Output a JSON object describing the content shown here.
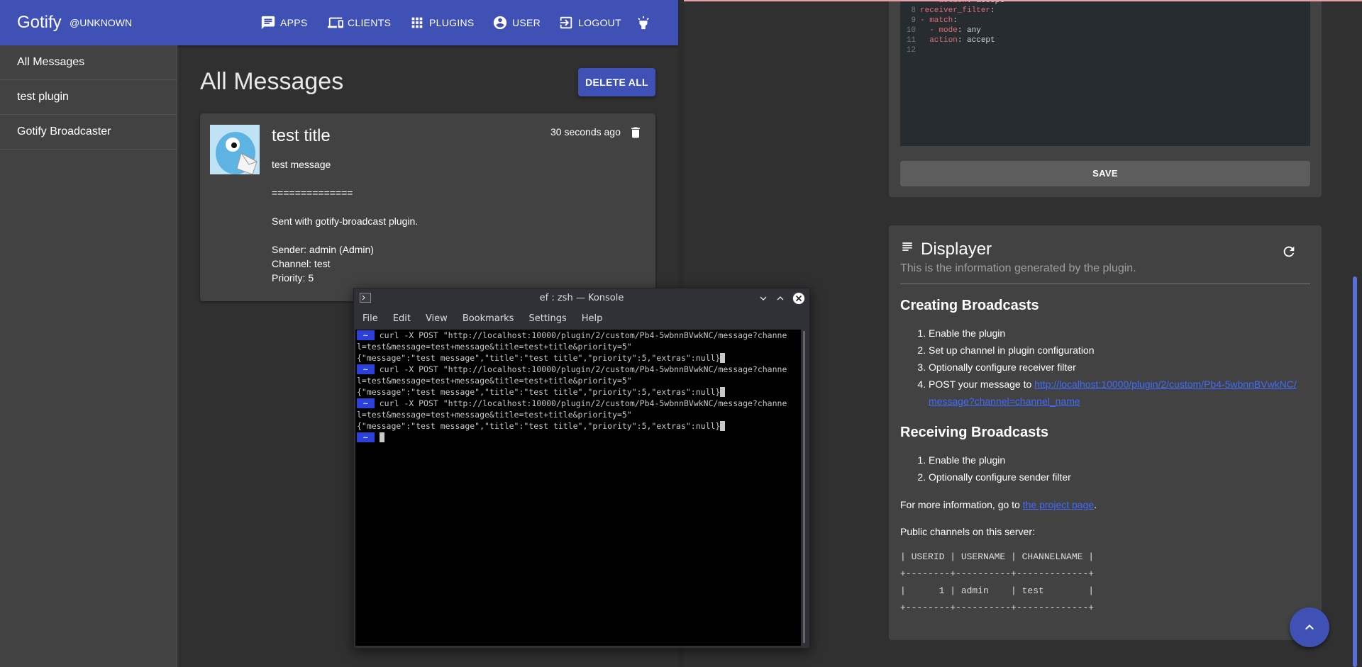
{
  "left": {
    "brand": "Gotify",
    "user_badge": "@UNKNOWN",
    "nav": {
      "apps": "APPS",
      "clients": "CLIENTS",
      "plugins": "PLUGINS",
      "user": "USER",
      "logout": "LOGOUT"
    },
    "sidebar": [
      "All Messages",
      "test plugin",
      "Gotify Broadcaster"
    ],
    "page_title": "All Messages",
    "delete_all": "DELETE ALL",
    "message": {
      "title": "test title",
      "time": "30 seconds ago",
      "body": "test message\n\n==============\n\nSent with gotify-broadcast plugin.\n\nSender: admin (Admin)\nChannel: test\nPriority: 5"
    }
  },
  "right": {
    "code_lines": [
      {
        "n": "",
        "text": "  - action: accept"
      },
      {
        "n": "8",
        "text": "receiver_filter:"
      },
      {
        "n": "9",
        "text": "- match:"
      },
      {
        "n": "10",
        "text": "  - mode: any"
      },
      {
        "n": "11",
        "text": "  action: accept"
      },
      {
        "n": "12",
        "text": ""
      }
    ],
    "save": "SAVE",
    "displayer": {
      "title": "Displayer",
      "subtitle": "This is the information generated by the plugin.",
      "h_creating": "Creating Broadcasts",
      "creating_items": [
        "Enable the plugin",
        "Set up channel in plugin configuration",
        "Optionally configure receiver filter"
      ],
      "post_prefix": "POST your message to ",
      "post_link": "http://localhost:10000/plugin/2/custom/Pb4-5wbnnBVwkNC/message?channel=channel_name",
      "h_receiving": "Receiving Broadcasts",
      "receiving_items": [
        "Enable the plugin",
        "Optionally configure sender filter"
      ],
      "more_info_prefix": "For more information, go to ",
      "more_info_link": "the project page",
      "more_info_suffix": ".",
      "public_channels": "Public channels on this server:",
      "table": "| USERID | USERNAME | CHANNELNAME |\n+--------+----------+-------------+\n|      1 | admin    | test        |\n+--------+----------+-------------+"
    }
  },
  "konsole": {
    "title": "ef : zsh — Konsole",
    "menu": [
      "File",
      "Edit",
      "View",
      "Bookmarks",
      "Settings",
      "Help"
    ],
    "prompt": "~",
    "lines": [
      {
        "prompt": true,
        "text": "curl -X POST \"http://localhost:10000/plugin/2/custom/Pb4-5wbnnBVwkNC/message?channe"
      },
      {
        "prompt": false,
        "text": "l=test&message=test+message&title=test+title&priority=5\""
      },
      {
        "prompt": false,
        "text": "{\"message\":\"test message\",\"title\":\"test title\",\"priority\":5,\"extras\":null}",
        "cursor": true
      },
      {
        "prompt": true,
        "text": "curl -X POST \"http://localhost:10000/plugin/2/custom/Pb4-5wbnnBVwkNC/message?channe"
      },
      {
        "prompt": false,
        "text": "l=test&message=test+message&title=test+title&priority=5\""
      },
      {
        "prompt": false,
        "text": "{\"message\":\"test message\",\"title\":\"test title\",\"priority\":5,\"extras\":null}",
        "cursor": true
      },
      {
        "prompt": true,
        "text": "curl -X POST \"http://localhost:10000/plugin/2/custom/Pb4-5wbnnBVwkNC/message?channe"
      },
      {
        "prompt": false,
        "text": "l=test&message=test+message&title=test+title&priority=5\""
      },
      {
        "prompt": false,
        "text": "{\"message\":\"test message\",\"title\":\"test title\",\"priority\":5,\"extras\":null}",
        "cursor": true
      },
      {
        "prompt": true,
        "text": "",
        "cursor": true
      }
    ]
  },
  "colors": {
    "primary": "#3f51b5",
    "background": "#303030",
    "card": "#424242",
    "terminal_bg": "#000000",
    "prompt": "#2c3fd6",
    "link": "#3f6bff"
  }
}
